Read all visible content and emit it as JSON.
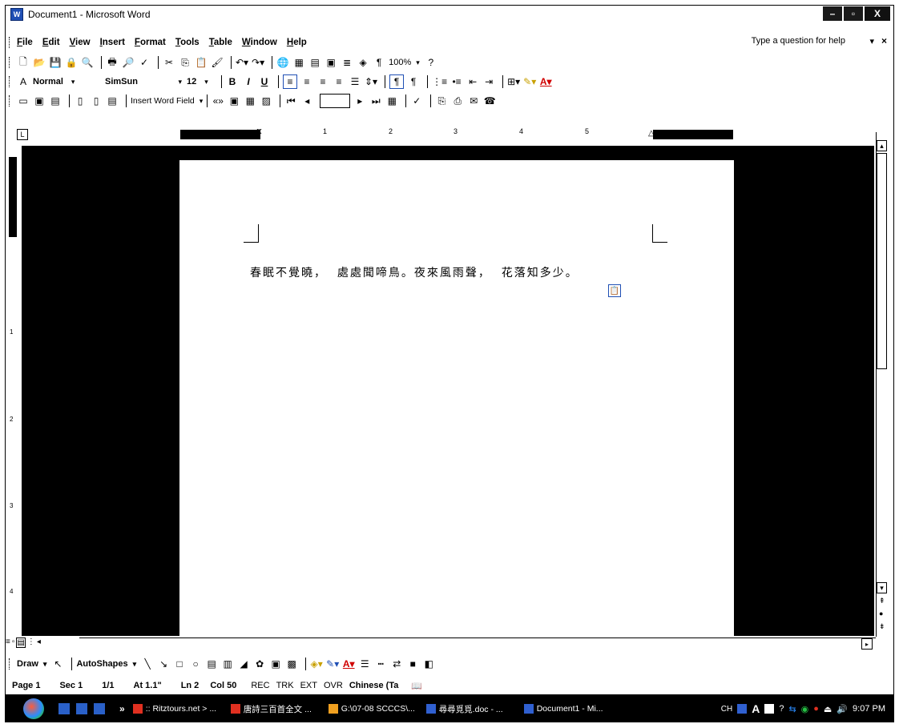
{
  "window": {
    "title": "Document1 - Microsoft Word",
    "minimize": "–",
    "restore": "▫",
    "close": "X"
  },
  "menubar": {
    "items": [
      "File",
      "Edit",
      "View",
      "Insert",
      "Format",
      "Tools",
      "Table",
      "Window",
      "Help"
    ],
    "ask_question": "Type a question for help",
    "ask_arrow": "▾",
    "doc_close": "×"
  },
  "formatting": {
    "style": "Normal",
    "font": "SimSun",
    "size": "12",
    "bold": "B",
    "italic": "I",
    "underline": "U"
  },
  "standard": {
    "zoom": "100%",
    "pilcrow": "¶"
  },
  "mailmerge": {
    "insert_word_field": "Insert Word Field"
  },
  "ruler": {
    "corner": "L",
    "marks": [
      "1",
      "2",
      "3",
      "4",
      "5"
    ]
  },
  "vruler": {
    "marks": [
      "1",
      "2",
      "3",
      "4"
    ]
  },
  "document": {
    "poem": "春眠不覺曉，  處處聞啼鳥。夜來風雨聲，  花落知多少。"
  },
  "drawing": {
    "draw": "Draw",
    "autoshapes": "AutoShapes"
  },
  "status": {
    "page": "Page 1",
    "sec": "Sec 1",
    "pages": "1/1",
    "at": "At 1.1\"",
    "ln": "Ln 2",
    "col": "Col 50",
    "rec": "REC",
    "trk": "TRK",
    "ext": "EXT",
    "ovr": "OVR",
    "lang": "Chinese (Ta"
  },
  "taskbar": {
    "tasks": [
      {
        "label": ":: Ritztours.net > ...",
        "color": "#e03020"
      },
      {
        "label": "唐詩三百首全文 ...",
        "color": "#e03020"
      },
      {
        "label": "G:\\07-08 SCCCS\\...",
        "color": "#f0a020"
      },
      {
        "label": "尋尋覓覓.doc - ...",
        "color": "#3060d0"
      },
      {
        "label": "Document1 - Mi...",
        "color": "#3060d0"
      }
    ],
    "lang": "CH",
    "time": "9:07 PM"
  }
}
